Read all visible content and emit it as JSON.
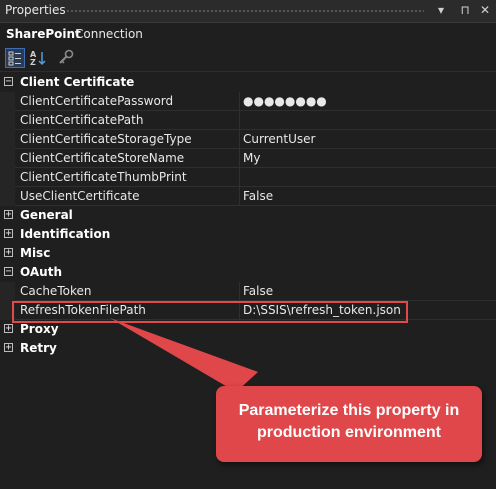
{
  "window": {
    "title": "Properties",
    "controls": [
      "▾",
      "⊓",
      "✕"
    ]
  },
  "object": {
    "name": "SharePoint",
    "type": "Connection"
  },
  "toolbar": {
    "buttons": [
      "categorized-icon",
      "alphabetical-icon",
      "property-pages-icon"
    ]
  },
  "grid": {
    "categories": {
      "client_certificate": {
        "label": "Client Certificate",
        "expander": "−"
      },
      "general": {
        "label": "General",
        "expander": "+"
      },
      "identification": {
        "label": "Identification",
        "expander": "+"
      },
      "misc": {
        "label": "Misc",
        "expander": "+"
      },
      "oauth": {
        "label": "OAuth",
        "expander": "−"
      },
      "proxy": {
        "label": "Proxy",
        "expander": "+"
      },
      "retry": {
        "label": "Retry",
        "expander": "+"
      }
    },
    "client_certificate_props": [
      {
        "name": "ClientCertificatePassword",
        "value": "●●●●●●●●"
      },
      {
        "name": "ClientCertificatePath",
        "value": ""
      },
      {
        "name": "ClientCertificateStorageType",
        "value": "CurrentUser"
      },
      {
        "name": "ClientCertificateStoreName",
        "value": "My"
      },
      {
        "name": "ClientCertificateThumbPrint",
        "value": ""
      },
      {
        "name": "UseClientCertificate",
        "value": "False"
      }
    ],
    "oauth_props": [
      {
        "name": "CacheToken",
        "value": "False"
      },
      {
        "name": "RefreshTokenFilePath",
        "value": "D:\\SSIS\\refresh_token.json"
      }
    ]
  },
  "callout": {
    "line1": "Parameterize this property in",
    "line2": "production environment",
    "color": "#e0474a"
  },
  "colors": {
    "background": "#1f1f1f",
    "highlight_border": "#e04a4a"
  }
}
